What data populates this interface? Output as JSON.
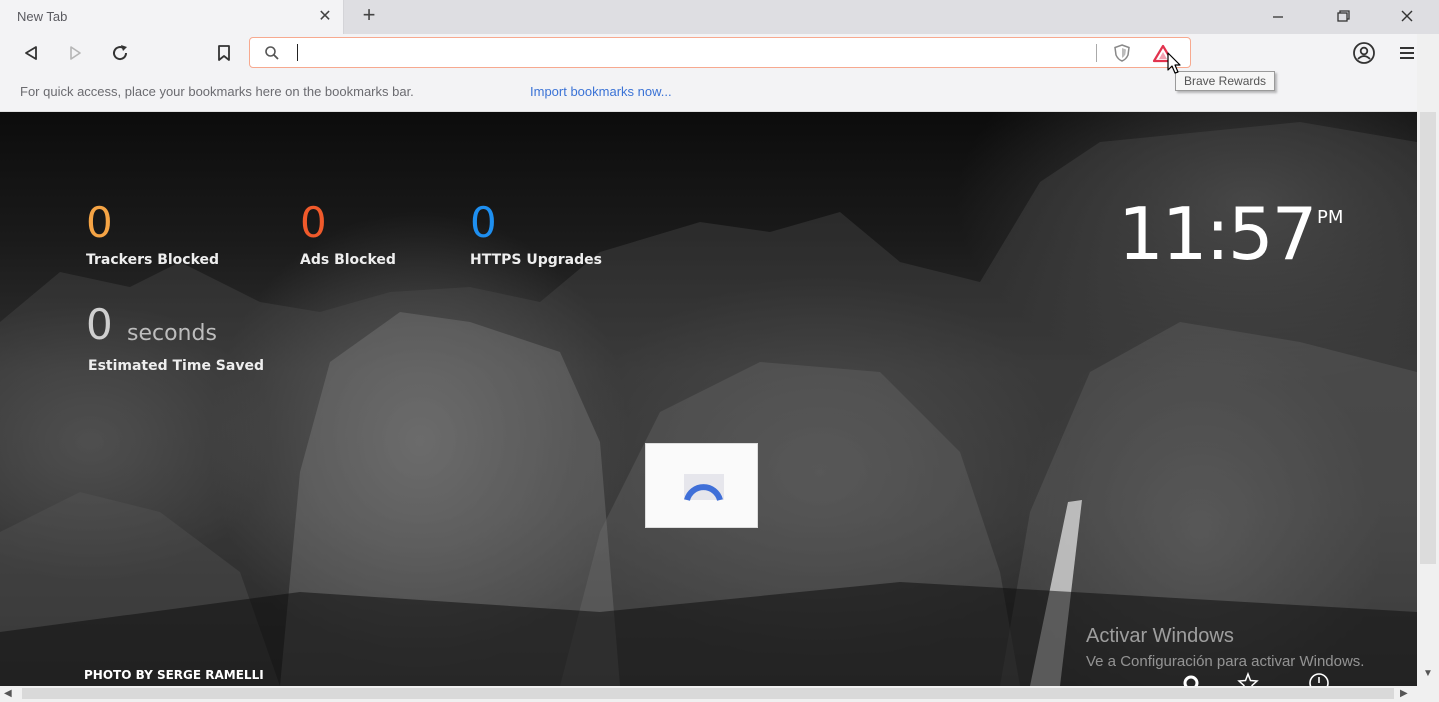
{
  "tab": {
    "title": "New Tab",
    "close_icon": "x-icon",
    "new_tab_icon": "plus-icon"
  },
  "window_controls": {
    "minimize": "—",
    "restore": "❐",
    "close": "✕"
  },
  "toolbar": {
    "back_icon": "back-icon",
    "forward_icon": "forward-icon",
    "reload_icon": "reload-icon",
    "bookmark_icon": "bookmark-icon",
    "menu_icon": "hamburger-icon",
    "profile_icon": "profile-icon"
  },
  "urlbar": {
    "value": "",
    "placeholder": "",
    "shield_icon": "brave-shield-icon",
    "rewards_icon": "brave-rewards-icon"
  },
  "tooltip": {
    "text": "Brave Rewards"
  },
  "bookmarks_bar": {
    "hint": "For quick access, place your bookmarks here on the bookmarks bar.",
    "import_link": "Import bookmarks now..."
  },
  "stats": [
    {
      "value": "0",
      "label": "Trackers Blocked",
      "color": "#f5a445"
    },
    {
      "value": "0",
      "label": "Ads Blocked",
      "color": "#f05a2b"
    },
    {
      "value": "0",
      "label": "HTTPS Upgrades",
      "color": "#1e8ff0"
    }
  ],
  "time_saved": {
    "value": "0",
    "unit": "seconds",
    "label": "Estimated Time Saved"
  },
  "clock": {
    "time": "11:57",
    "ampm": "PM"
  },
  "photo_credit": "PHOTO BY SERGE RAMELLI",
  "windows_activation": {
    "title": "Activar Windows",
    "subtitle": "Ve a Configuración para activar Windows."
  },
  "colors": {
    "accent": "#fb542b",
    "link": "#3b73d6",
    "urlbar_border": "#f7a98f"
  }
}
